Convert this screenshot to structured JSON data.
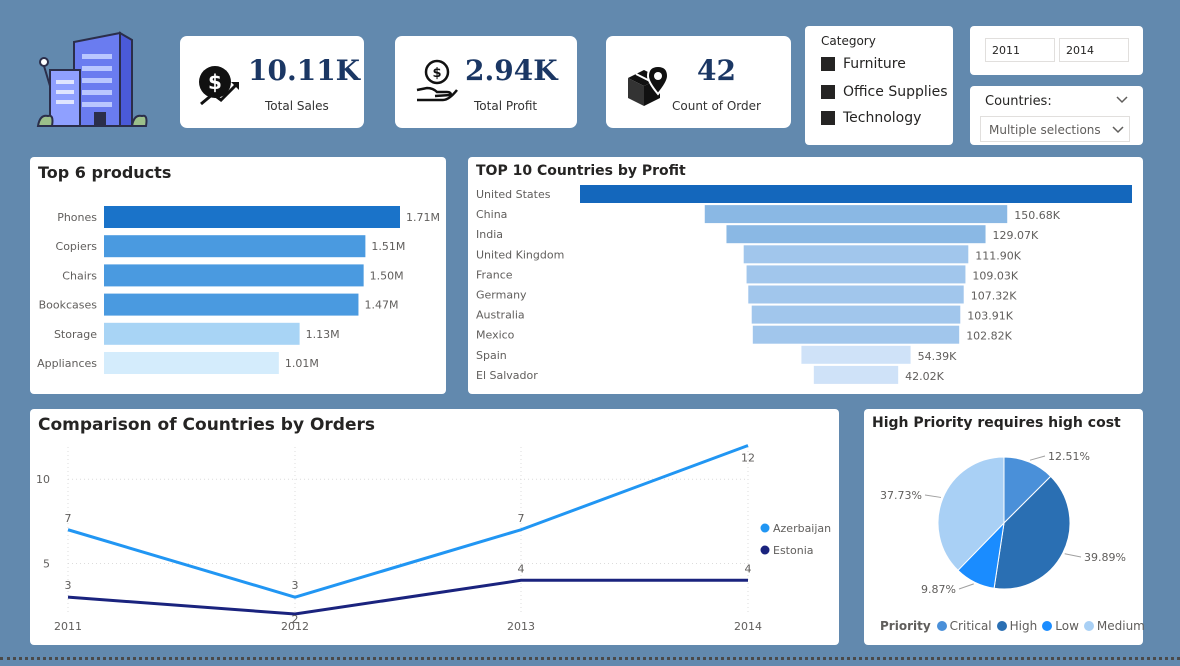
{
  "colors": {
    "background": "#6289ae",
    "kpi_text": "#1b3764",
    "dark_blue": "#1467bc",
    "mid_blue": "#4a9ae0",
    "light_blue": "#a8cdf2",
    "pale_blue": "#cfe6fa",
    "azerbaijan": "#2196f3",
    "estonia": "#1a237e"
  },
  "kpis": [
    {
      "value": "10.11K",
      "label": "Total Sales",
      "icon": "sales-growth-icon"
    },
    {
      "value": "2.94K",
      "label": "Total Profit",
      "icon": "hand-money-icon"
    },
    {
      "value": "42",
      "label": "Count of Order",
      "icon": "delivery-box-icon"
    }
  ],
  "category_slicer": {
    "title": "Category",
    "items": [
      "Furniture",
      "Office Supplies",
      "Technology"
    ]
  },
  "year_slicer": {
    "from": "2011",
    "to": "2014"
  },
  "countries_slicer": {
    "title": "Countries:",
    "value": "Multiple selections"
  },
  "chart_data": [
    {
      "type": "bar",
      "orientation": "horizontal",
      "title": "Top 6 products",
      "categories": [
        "Phones",
        "Copiers",
        "Chairs",
        "Bookcases",
        "Storage",
        "Appliances"
      ],
      "values": [
        1.71,
        1.51,
        1.5,
        1.47,
        1.13,
        1.01
      ],
      "value_labels": [
        "1.71M",
        "1.51M",
        "1.50M",
        "1.47M",
        "1.13M",
        "1.01M"
      ],
      "unit": "M"
    },
    {
      "type": "bar",
      "orientation": "funnel",
      "title": "TOP 10 Countries by Profit",
      "categories": [
        "United States",
        "China",
        "India",
        "United Kingdom",
        "France",
        "Germany",
        "Australia",
        "Mexico",
        "Spain",
        "El Salvador"
      ],
      "values": [
        275,
        150.68,
        129.07,
        111.9,
        109.03,
        107.32,
        103.91,
        102.82,
        54.39,
        42.02
      ],
      "value_labels": [
        "",
        "150.68K",
        "129.07K",
        "111.90K",
        "109.03K",
        "107.32K",
        "103.91K",
        "102.82K",
        "54.39K",
        "42.02K"
      ],
      "unit": "K"
    },
    {
      "type": "line",
      "title": "Comparison of Countries by Orders",
      "x": [
        "2011",
        "2012",
        "2013",
        "2014"
      ],
      "ylim": [
        2,
        12
      ],
      "yticks": [
        5,
        10
      ],
      "grid": true,
      "legend": "right",
      "series": [
        {
          "name": "Azerbaijan",
          "values": [
            7,
            3,
            7,
            12
          ]
        },
        {
          "name": "Estonia",
          "values": [
            3,
            2,
            4,
            4
          ]
        }
      ]
    },
    {
      "type": "pie",
      "title": "High Priority requires high cost",
      "legend_title": "Priority",
      "legend": "bottom",
      "categories": [
        "Critical",
        "High",
        "Low",
        "Medium"
      ],
      "values": [
        12.51,
        39.89,
        9.87,
        37.73
      ],
      "value_labels": [
        "12.51%",
        "39.89%",
        "9.87%",
        "37.73%"
      ],
      "colors": [
        "#4a90d9",
        "#2a6fb3",
        "#1a8cff",
        "#a9d0f5"
      ]
    }
  ]
}
